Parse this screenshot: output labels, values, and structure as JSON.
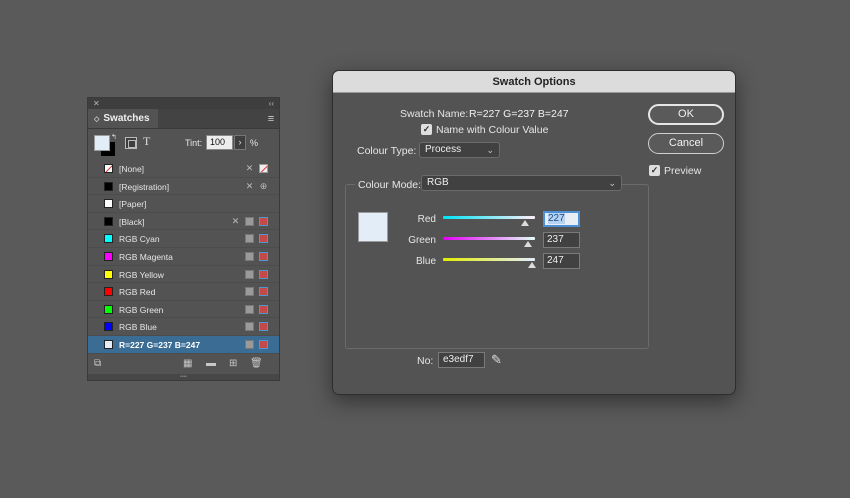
{
  "swatches_panel": {
    "close": "✕",
    "collapse": "‹‹",
    "tab_label": "Swatches",
    "tab_chevron": "◇",
    "menu_icon": "≡",
    "tint_label": "Tint:",
    "tint_value": "100",
    "tint_arrow": "›",
    "tint_unit": "%",
    "items": [
      {
        "name": "[None]",
        "color": "none"
      },
      {
        "name": "[Registration]",
        "color": "#000000"
      },
      {
        "name": "[Paper]",
        "color": "#ffffff"
      },
      {
        "name": "[Black]",
        "color": "#000000"
      },
      {
        "name": "RGB Cyan",
        "color": "#00ffff"
      },
      {
        "name": "RGB Magenta",
        "color": "#ff00ff"
      },
      {
        "name": "RGB Yellow",
        "color": "#ffff00"
      },
      {
        "name": "RGB Red",
        "color": "#ff0000"
      },
      {
        "name": "RGB Green",
        "color": "#00ff00"
      },
      {
        "name": "RGB Blue",
        "color": "#0000ff"
      },
      {
        "name": "R=227 G=237 B=247",
        "color": "#e3edf7",
        "selected": true
      }
    ],
    "fill_color": "#e3edf7",
    "stroke_color": "#000000"
  },
  "dialog": {
    "title": "Swatch Options",
    "swatch_name_label": "Swatch Name:",
    "swatch_name_value": "R=227 G=237 B=247",
    "name_with_value_label": "Name with Colour Value",
    "colour_type_label": "Colour Type:",
    "colour_type_value": "Process",
    "colour_mode_label": "Colour Mode:",
    "colour_mode_value": "RGB",
    "ok_label": "OK",
    "cancel_label": "Cancel",
    "preview_label": "Preview",
    "red_label": "Red",
    "red_value": "227",
    "green_label": "Green",
    "green_value": "237",
    "blue_label": "Blue",
    "blue_value": "247",
    "no_label": "No:",
    "hex_value": "e3edf7",
    "preview_color": "#e3edf7",
    "sliders": {
      "red": 0.89,
      "green": 0.929,
      "blue": 0.969
    }
  }
}
